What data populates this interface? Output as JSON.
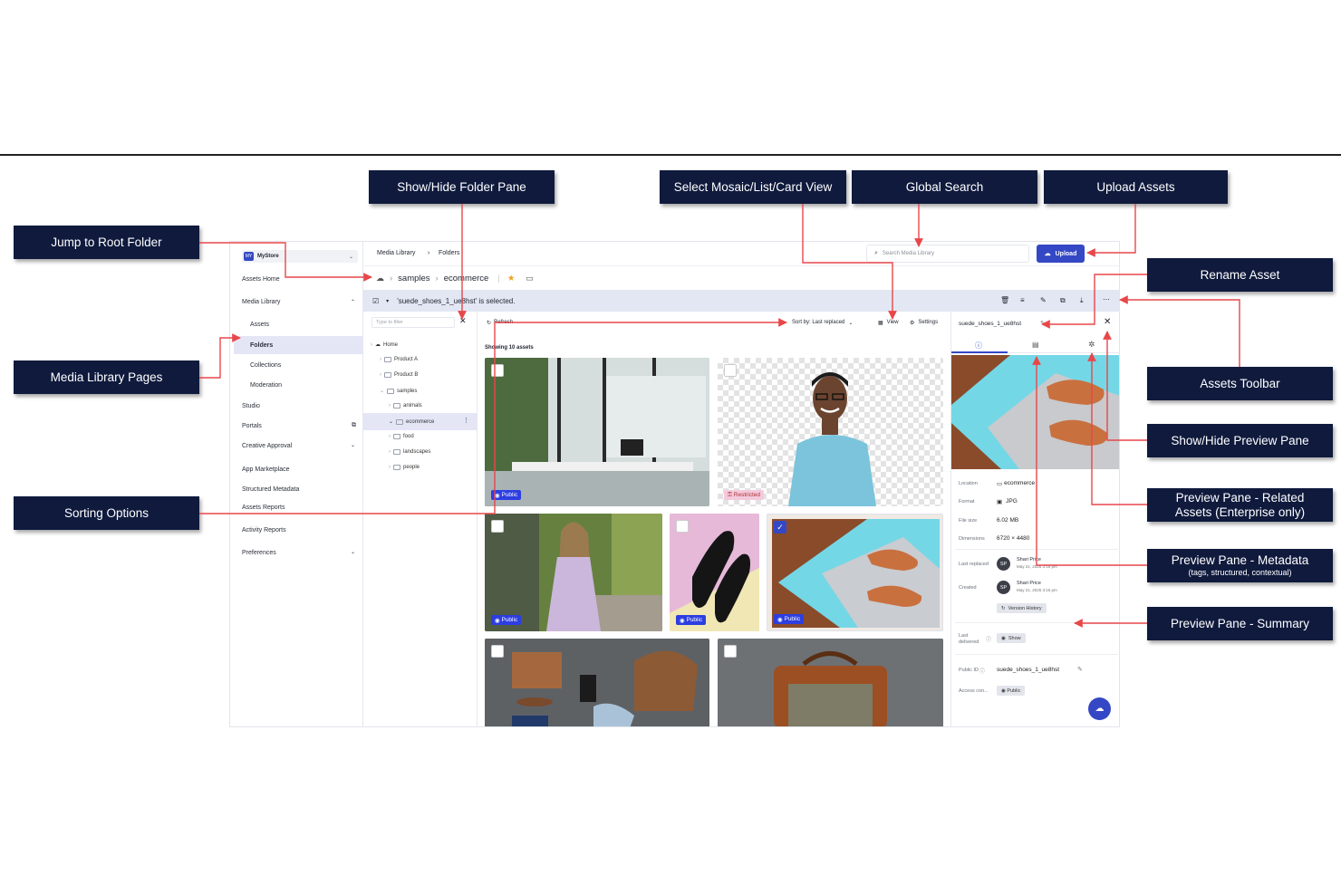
{
  "callouts": {
    "show_hide_folder_pane": "Show/Hide Folder Pane",
    "select_view": "Select Mosaic/List/Card View",
    "global_search": "Global Search",
    "upload_assets": "Upload Assets",
    "jump_root": "Jump to Root Folder",
    "rename_asset": "Rename Asset",
    "media_library_pages": "Media Library Pages",
    "assets_toolbar": "Assets Toolbar",
    "show_hide_preview": "Show/Hide Preview Pane",
    "related_assets": "Preview Pane - Related Assets (Enterprise only)",
    "sorting_options": "Sorting Options",
    "metadata": "Preview Pane - Metadata",
    "metadata_sub": "(tags, structured, contextual)",
    "summary": "Preview Pane - Summary"
  },
  "sidebar": {
    "logo": "MY",
    "brand": "MyStore",
    "assets_home": "Assets Home",
    "media_library": "Media Library",
    "assets": "Assets",
    "folders": "Folders",
    "collections": "Collections",
    "moderation": "Moderation",
    "studio": "Studio",
    "portals": "Portals",
    "creative_approval": "Creative Approval",
    "app_marketplace": "App Marketplace",
    "structured_metadata": "Structured Metadata",
    "assets_reports": "Assets Reports",
    "activity_reports": "Activity Reports",
    "preferences": "Preferences"
  },
  "topbar": {
    "crumb1": "Media Library",
    "crumb2": "Folders",
    "search_placeholder": "Search Media Library",
    "upload": "Upload"
  },
  "path": {
    "seg1": "samples",
    "seg2": "ecommerce"
  },
  "selection": {
    "text": "'suede_shoes_1_ue8hst' is selected."
  },
  "folders": {
    "filter_placeholder": "Type to filter",
    "home": "Home",
    "items": [
      "Product A",
      "Product B",
      "samples",
      "animals",
      "ecommerce",
      "food",
      "landscapes",
      "people"
    ]
  },
  "grid": {
    "refresh": "Refresh",
    "sort": "Sort by: Last replaced",
    "view": "View",
    "settings": "Settings",
    "showing": "Showing 10 assets",
    "public": "Public",
    "restricted": "Restricted"
  },
  "preview": {
    "asset_name": "suede_shoes_1_ue8hst",
    "location_label": "Location",
    "location": "ecommerce",
    "format_label": "Format",
    "format": "JPG",
    "filesize_label": "File size",
    "filesize": "6.02 MB",
    "dimensions_label": "Dimensions",
    "dimensions": "6720 × 4480",
    "last_replaced_label": "Last replaced",
    "created_label": "Created",
    "user_initials": "SP",
    "user": "Shari Price",
    "date": "May 21, 2025 3:16 pm",
    "version_history": "Version History",
    "last_delivered_label_1": "Last",
    "last_delivered_label_2": "delivered",
    "show": "Show",
    "public_id_label": "Public ID",
    "public_id": "suede_shoes_1_ue8hst",
    "access_label": "Access con...",
    "access": "Public"
  }
}
